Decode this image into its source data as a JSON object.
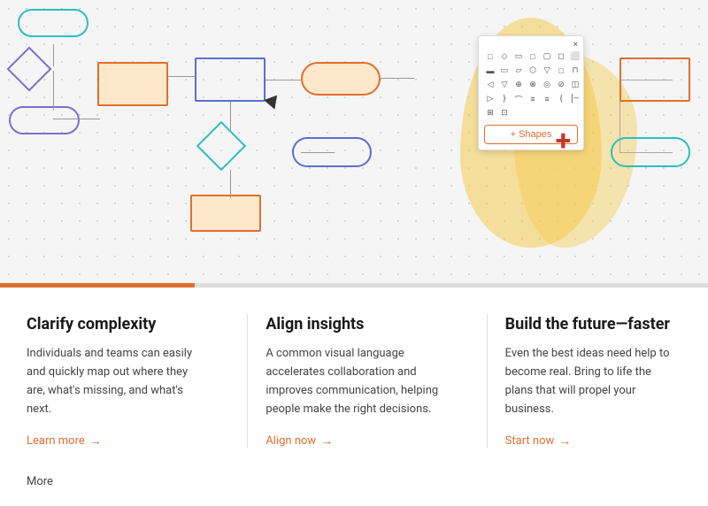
{
  "hero": {
    "shapes_panel": {
      "close_label": "×",
      "shapes_button_label": "+ Shapes"
    },
    "plus_icon": "+"
  },
  "progress": {
    "filled_pct": "28%"
  },
  "columns": [
    {
      "id": "col-clarify",
      "title": "Clarify complexity",
      "body": "Individuals and teams can easily and quickly map out where they are, what's missing, and what's next.",
      "link_label": "Learn more",
      "link_arrow": "→"
    },
    {
      "id": "col-align",
      "title": "Align insights",
      "body": "A common visual language accelerates collaboration and improves communication, helping people make the right decisions.",
      "link_label": "Align now",
      "link_arrow": "→"
    },
    {
      "id": "col-build",
      "title": "Build the future—faster",
      "body": "Even the best ideas need help to become real. Bring to life the plans that will propel your business.",
      "link_label": "Start now",
      "link_arrow": "→"
    }
  ],
  "footer": {
    "more_label": "More"
  },
  "shapes_rows": [
    [
      "□",
      "◇",
      "□",
      "□",
      "□",
      "□",
      "□"
    ],
    [
      "□",
      "□",
      "▭",
      "▱",
      "◻",
      "□",
      "□"
    ],
    [
      "□",
      "□",
      "□",
      "▽",
      "⊕",
      "⊗",
      "□"
    ],
    [
      "▷",
      "▽",
      "⌒",
      "}",
      "≡",
      "{",
      "[—"
    ],
    [
      "⊞",
      "⊡",
      "",
      "",
      "",
      "",
      ""
    ]
  ]
}
